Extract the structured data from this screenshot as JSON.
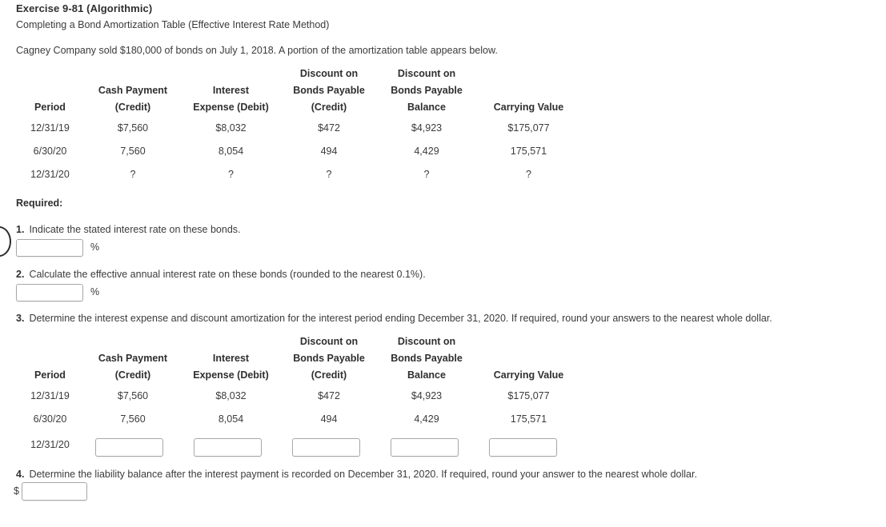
{
  "header": {
    "exercise_title": "Exercise 9-81 (Algorithmic)",
    "subtitle": "Completing a Bond Amortization Table (Effective Interest Rate Method)",
    "intro": "Cagney Company sold $180,000 of bonds on July 1, 2018. A portion of the amortization table appears below."
  },
  "table_headers": {
    "period": "Period",
    "cash_payment_l1": "Cash Payment",
    "cash_payment_l2": "(Credit)",
    "interest_l1": "Interest",
    "interest_l2": "Expense (Debit)",
    "discount_credit_l1": "Discount on",
    "discount_credit_l2": "Bonds Payable",
    "discount_credit_l3": "(Credit)",
    "discount_balance_l1": "Discount on",
    "discount_balance_l2": "Bonds Payable",
    "discount_balance_l3": "Balance",
    "carrying_value": "Carrying Value"
  },
  "table_one": {
    "rows": [
      {
        "period": "12/31/19",
        "cash_payment": "$7,560",
        "interest_expense": "$8,032",
        "discount_credit": "$472",
        "discount_balance": "$4,923",
        "carrying_value": "$175,077"
      },
      {
        "period": "6/30/20",
        "cash_payment": "7,560",
        "interest_expense": "8,054",
        "discount_credit": "494",
        "discount_balance": "4,429",
        "carrying_value": "175,571"
      },
      {
        "period": "12/31/20",
        "cash_payment": "?",
        "interest_expense": "?",
        "discount_credit": "?",
        "discount_balance": "?",
        "carrying_value": "?"
      }
    ]
  },
  "table_two": {
    "rows": [
      {
        "period": "12/31/19",
        "cash_payment": "$7,560",
        "interest_expense": "$8,032",
        "discount_credit": "$472",
        "discount_balance": "$4,923",
        "carrying_value": "$175,077"
      },
      {
        "period": "6/30/20",
        "cash_payment": "7,560",
        "interest_expense": "8,054",
        "discount_credit": "494",
        "discount_balance": "4,429",
        "carrying_value": "175,571"
      }
    ],
    "input_row_period": "12/31/20",
    "inputs": {
      "cash_payment": "",
      "interest_expense": "",
      "discount_credit": "",
      "discount_balance": "",
      "carrying_value": ""
    }
  },
  "required_label": "Required:",
  "questions": [
    {
      "number": "1.",
      "text": "Indicate the stated interest rate on these bonds.",
      "suffix": "%",
      "value": ""
    },
    {
      "number": "2.",
      "text": "Calculate the effective annual interest rate on these bonds (rounded to the nearest 0.1%).",
      "suffix": "%",
      "value": ""
    },
    {
      "number": "3.",
      "text": "Determine the interest expense and discount amortization for the interest period ending December 31, 2020. If required, round your answers to the nearest whole dollar."
    },
    {
      "number": "4.",
      "text": "Determine the liability balance after the interest payment is recorded on December 31, 2020. If required, round your answer to the nearest whole dollar.",
      "prefix": "$",
      "value": ""
    }
  ],
  "colors": {
    "text": "#3b3b3b",
    "heading": "#2f2f2f",
    "field_border": "#a8a8a8",
    "background": "#ffffff"
  }
}
